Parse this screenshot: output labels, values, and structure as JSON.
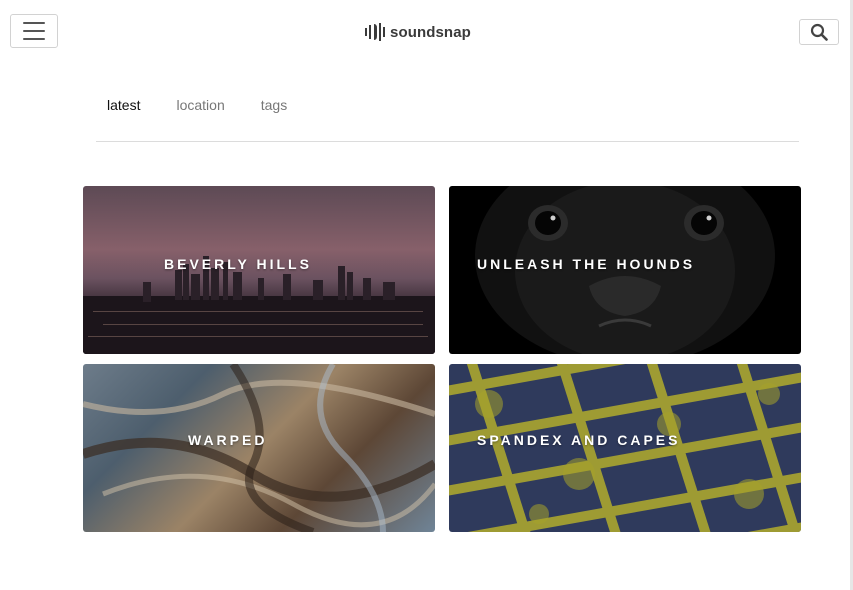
{
  "header": {
    "brand": "soundsnap",
    "menu_icon": "hamburger-icon",
    "search_icon": "search-icon"
  },
  "tabs": [
    {
      "label": "latest",
      "active": true
    },
    {
      "label": "location",
      "active": false
    },
    {
      "label": "tags",
      "active": false
    }
  ],
  "cards": [
    {
      "title": "BEVERLY HILLS"
    },
    {
      "title": "UNLEASH THE HOUNDS"
    },
    {
      "title": "WARPED"
    },
    {
      "title": "SPANDEX AND CAPES"
    }
  ]
}
